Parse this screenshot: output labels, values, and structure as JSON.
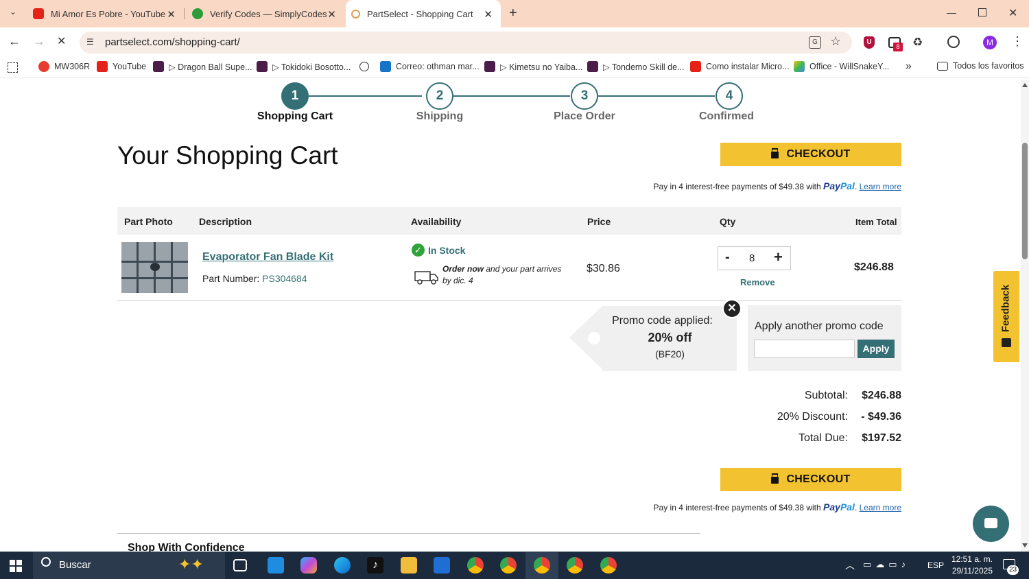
{
  "browser": {
    "tabs": [
      {
        "title": "Mi Amor Es Pobre - YouTube"
      },
      {
        "title": "Verify Codes — SimplyCodes"
      },
      {
        "title": "PartSelect - Shopping Cart"
      }
    ],
    "url": "partselect.com/shopping-cart/",
    "bookmarks": [
      {
        "label": "MW306R"
      },
      {
        "label": "YouTube"
      },
      {
        "label": "▷ Dragon Ball Supe..."
      },
      {
        "label": "▷ Tokidoki Bosotto..."
      },
      {
        "label": "Correo: othman mar..."
      },
      {
        "label": "▷ Kimetsu no Yaiba..."
      },
      {
        "label": "▷ Tondemo Skill de..."
      },
      {
        "label": "Como instalar Micro..."
      },
      {
        "label": "Office - WillSnakeY..."
      }
    ],
    "all_bookmarks": "Todos los favoritos",
    "extensions_badge": "8",
    "profile_initial": "M"
  },
  "steps": [
    {
      "number": "1",
      "label": "Shopping Cart"
    },
    {
      "number": "2",
      "label": "Shipping"
    },
    {
      "number": "3",
      "label": "Place Order"
    },
    {
      "number": "4",
      "label": "Confirmed"
    }
  ],
  "cart": {
    "heading": "Your Shopping Cart",
    "checkout_label": "CHECKOUT",
    "paypal_text": "Pay in 4 interest-free payments of $49.38 with",
    "paypal_brand_a": "Pay",
    "paypal_brand_b": "Pal",
    "learn_more": "Learn more",
    "columns": {
      "photo": "Part Photo",
      "description": "Description",
      "availability": "Availability",
      "price": "Price",
      "qty": "Qty",
      "total": "Item Total"
    },
    "item": {
      "name": "Evaporator Fan Blade Kit",
      "part_number_label": "Part Number:",
      "part_number": "PS304684",
      "stock": "In Stock",
      "order_now": "Order now",
      "arrival": "and your part arrives",
      "arrival_date": "by dic. 4",
      "price": "$30.86",
      "qty_minus": "-",
      "qty": "8",
      "qty_plus": "+",
      "remove": "Remove",
      "total": "$246.88"
    },
    "promo": {
      "applied_label": "Promo code applied:",
      "discount": "20% off",
      "code": "(BF20)",
      "another_label": "Apply another promo code",
      "input_value": "",
      "apply_label": "Apply"
    },
    "summary": {
      "subtotal_label": "Subtotal:",
      "subtotal": "$246.88",
      "discount_label": "20% Discount:",
      "discount": "- $49.36",
      "total_label": "Total Due:",
      "total": "$197.52"
    },
    "confidence": "Shop With Confidence",
    "feedback": "Feedback"
  },
  "taskbar": {
    "search_placeholder": "Buscar",
    "language": "ESP",
    "time": "12:51 a. m.",
    "date": "29/11/2025",
    "notifications": "23"
  },
  "colors": {
    "teal": "#346f75",
    "checkout": "#f2c230",
    "tab_strip": "#f9d9c6"
  }
}
